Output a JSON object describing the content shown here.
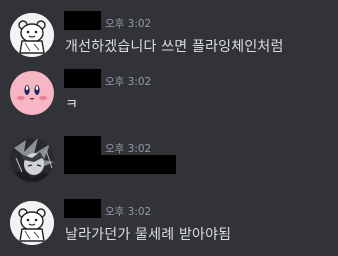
{
  "messages": [
    {
      "avatar": "bear-doodle-avatar",
      "author": "[redacted]",
      "timestamp": "오후 3:02",
      "content": "개선하겠습니다 쓰면 플라잉체인처럼"
    },
    {
      "avatar": "kirby-avatar",
      "author": "[redacted]",
      "timestamp": "오후 3:02",
      "content": "ㅋ"
    },
    {
      "avatar": "dark-anime-character-avatar",
      "author": "[redacted]",
      "timestamp": "오후 3:02",
      "content": "[redacted]"
    },
    {
      "avatar": "bear-doodle-avatar",
      "author": "[redacted]",
      "timestamp": "오후 3:02",
      "content": "날라가던가 물세례 받아야됨"
    }
  ],
  "colors": {
    "background": "#313338",
    "text": "#dbdee1",
    "timestamp": "#949ba4",
    "redaction": "#000000",
    "kirby_pink": "#f6b6c3"
  }
}
